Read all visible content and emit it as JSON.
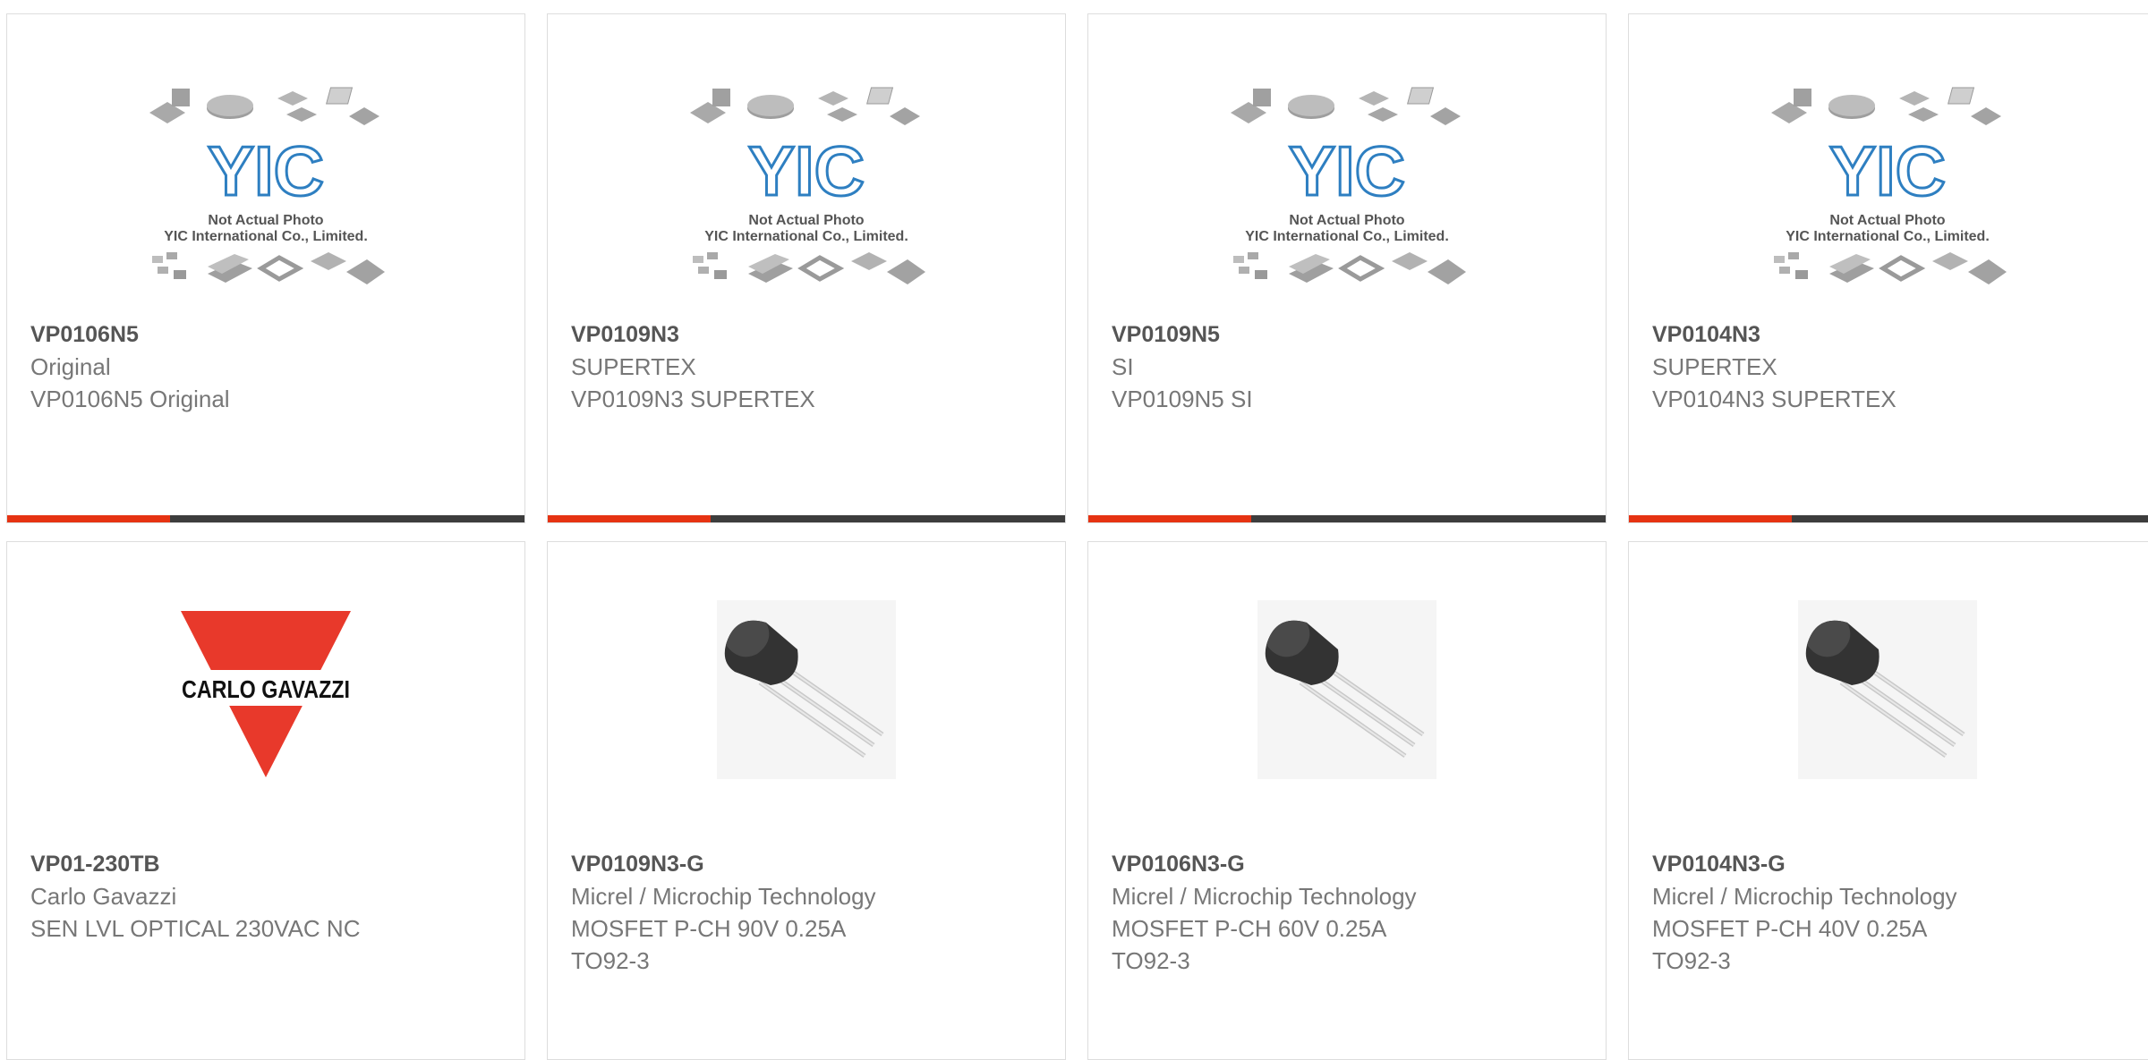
{
  "products": [
    {
      "part": "VP0106N5",
      "brand": "Original",
      "desc": "VP0106N5 Original",
      "desc2": "",
      "image": "yic-placeholder"
    },
    {
      "part": "VP0109N3",
      "brand": "SUPERTEX",
      "desc": "VP0109N3 SUPERTEX",
      "desc2": "",
      "image": "yic-placeholder"
    },
    {
      "part": "VP0109N5",
      "brand": "SI",
      "desc": "VP0109N5 SI",
      "desc2": "",
      "image": "yic-placeholder"
    },
    {
      "part": "VP0104N3",
      "brand": "SUPERTEX",
      "desc": "VP0104N3 SUPERTEX",
      "desc2": "",
      "image": "yic-placeholder"
    },
    {
      "part": "VP01-230TB",
      "brand": "Carlo Gavazzi",
      "desc": "SEN LVL OPTICAL 230VAC NC",
      "desc2": "",
      "image": "carlo-gavazzi-logo"
    },
    {
      "part": "VP0109N3-G",
      "brand": "Micrel / Microchip Technology",
      "desc": "MOSFET P-CH 90V 0.25A",
      "desc2": "TO92-3",
      "image": "to92-transistor"
    },
    {
      "part": "VP0106N3-G",
      "brand": "Micrel / Microchip Technology",
      "desc": "MOSFET P-CH 60V 0.25A",
      "desc2": "TO92-3",
      "image": "to92-transistor"
    },
    {
      "part": "VP0104N3-G",
      "brand": "Micrel / Microchip Technology",
      "desc": "MOSFET P-CH 40V 0.25A",
      "desc2": "TO92-3",
      "image": "to92-transistor"
    }
  ],
  "placeholder": {
    "logo": "YIC",
    "line1": "Not Actual Photo",
    "line2": "YIC International Co., Limited."
  },
  "gavazzi_logo_text": "CARLO GAVAZZI",
  "colors": {
    "accent": "#e63312",
    "bar": "#3d3d3d",
    "yic_blue": "#2e7fc1",
    "gavazzi_red": "#e8392b"
  }
}
